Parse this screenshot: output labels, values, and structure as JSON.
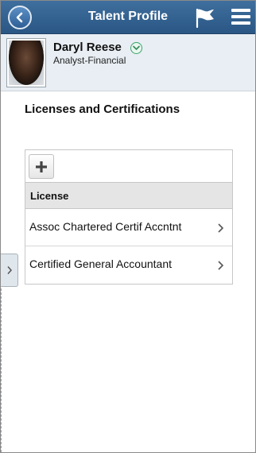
{
  "header": {
    "title": "Talent Profile",
    "back_icon": "back-arrow-icon",
    "flag_icon": "flag-icon",
    "menu_icon": "hamburger-menu-icon",
    "background_color": "#2f5d8c"
  },
  "employee": {
    "name": "Daryl Reese",
    "role": "Analyst-Financial",
    "details_icon": "chevron-down-circle-icon"
  },
  "section": {
    "title": "Licenses and Certifications"
  },
  "grid": {
    "add_icon": "plus-icon",
    "column_header": "License",
    "rows": [
      {
        "label": "Assoc Chartered Certif Accntnt"
      },
      {
        "label": "Certified General Accountant"
      }
    ]
  },
  "side_panel": {
    "toggle_icon": "chevron-right-icon"
  }
}
